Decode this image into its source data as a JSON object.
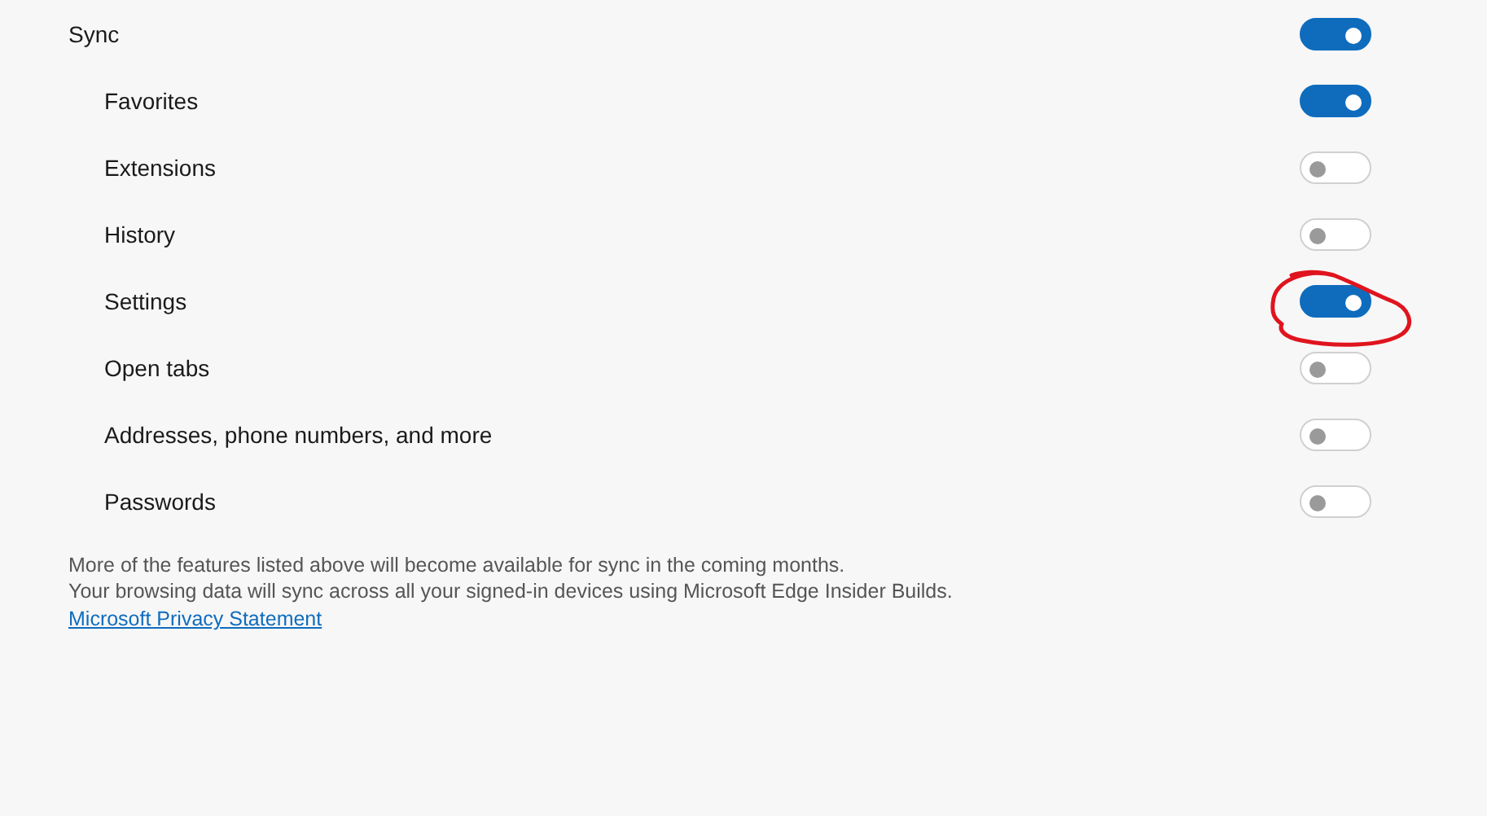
{
  "sync": {
    "label": "Sync",
    "on": true
  },
  "items": [
    {
      "label": "Favorites",
      "on": true
    },
    {
      "label": "Extensions",
      "on": false
    },
    {
      "label": "History",
      "on": false
    },
    {
      "label": "Settings",
      "on": true
    },
    {
      "label": "Open tabs",
      "on": false
    },
    {
      "label": "Addresses, phone numbers, and more",
      "on": false
    },
    {
      "label": "Passwords",
      "on": false
    }
  ],
  "footer": {
    "lines": [
      "More of the features listed above will become available for sync in the coming months.",
      "Your browsing data will sync across all your signed-in devices using Microsoft Edge Insider Builds."
    ],
    "link": "Microsoft Privacy Statement"
  }
}
